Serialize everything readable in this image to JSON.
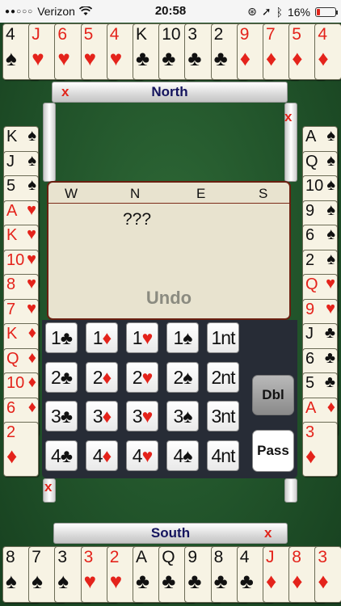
{
  "status_bar": {
    "carrier": "Verizon",
    "time": "20:58",
    "battery": "16%",
    "battery_level": 0.16,
    "icons": [
      "signal-dots",
      "wifi-icon",
      "orientation-lock-icon",
      "location-icon",
      "bluetooth-icon",
      "battery-icon"
    ]
  },
  "colors": {
    "felt": "#21532a",
    "red_suit": "#e4231b",
    "name_text": "#14145e",
    "x_red": "#e0261b"
  },
  "suits": {
    "S": "♠",
    "H": "♥",
    "D": "♦",
    "C": "♣"
  },
  "north": {
    "name": "North",
    "close": "x",
    "cards": [
      {
        "rank": "4",
        "suit": "S"
      },
      {
        "rank": "J",
        "suit": "H"
      },
      {
        "rank": "6",
        "suit": "H"
      },
      {
        "rank": "5",
        "suit": "H"
      },
      {
        "rank": "4",
        "suit": "H"
      },
      {
        "rank": "K",
        "suit": "C"
      },
      {
        "rank": "10",
        "suit": "C"
      },
      {
        "rank": "3",
        "suit": "C"
      },
      {
        "rank": "2",
        "suit": "C"
      },
      {
        "rank": "9",
        "suit": "D"
      },
      {
        "rank": "7",
        "suit": "D"
      },
      {
        "rank": "5",
        "suit": "D"
      },
      {
        "rank": "4",
        "suit": "D"
      }
    ]
  },
  "west": {
    "close": "x",
    "cards": [
      {
        "rank": "K",
        "suit": "S"
      },
      {
        "rank": "J",
        "suit": "S"
      },
      {
        "rank": "5",
        "suit": "S"
      },
      {
        "rank": "A",
        "suit": "H"
      },
      {
        "rank": "K",
        "suit": "H"
      },
      {
        "rank": "10",
        "suit": "H"
      },
      {
        "rank": "8",
        "suit": "H"
      },
      {
        "rank": "7",
        "suit": "H"
      },
      {
        "rank": "K",
        "suit": "D"
      },
      {
        "rank": "Q",
        "suit": "D"
      },
      {
        "rank": "10",
        "suit": "D"
      },
      {
        "rank": "6",
        "suit": "D"
      },
      {
        "rank": "2",
        "suit": "D"
      }
    ]
  },
  "east": {
    "close": "x",
    "cards": [
      {
        "rank": "A",
        "suit": "S"
      },
      {
        "rank": "Q",
        "suit": "S"
      },
      {
        "rank": "10",
        "suit": "S"
      },
      {
        "rank": "9",
        "suit": "S"
      },
      {
        "rank": "6",
        "suit": "S"
      },
      {
        "rank": "2",
        "suit": "S"
      },
      {
        "rank": "Q",
        "suit": "H"
      },
      {
        "rank": "9",
        "suit": "H"
      },
      {
        "rank": "J",
        "suit": "C"
      },
      {
        "rank": "6",
        "suit": "C"
      },
      {
        "rank": "5",
        "suit": "C"
      },
      {
        "rank": "A",
        "suit": "D"
      },
      {
        "rank": "3",
        "suit": "D"
      }
    ]
  },
  "south": {
    "name": "South",
    "close": "x",
    "cards": [
      {
        "rank": "8",
        "suit": "S"
      },
      {
        "rank": "7",
        "suit": "S"
      },
      {
        "rank": "3",
        "suit": "S"
      },
      {
        "rank": "3",
        "suit": "H"
      },
      {
        "rank": "2",
        "suit": "H"
      },
      {
        "rank": "A",
        "suit": "C"
      },
      {
        "rank": "Q",
        "suit": "C"
      },
      {
        "rank": "9",
        "suit": "C"
      },
      {
        "rank": "8",
        "suit": "C"
      },
      {
        "rank": "4",
        "suit": "C"
      },
      {
        "rank": "J",
        "suit": "D"
      },
      {
        "rank": "8",
        "suit": "D"
      },
      {
        "rank": "3",
        "suit": "D"
      }
    ]
  },
  "history": {
    "columns": [
      "W",
      "N",
      "E",
      "S"
    ],
    "entry": "???",
    "undo_label": "Undo"
  },
  "bidbox": {
    "rows": [
      [
        {
          "level": "1",
          "strain": "C"
        },
        {
          "level": "1",
          "strain": "D"
        },
        {
          "level": "1",
          "strain": "H"
        },
        {
          "level": "1",
          "strain": "S"
        },
        {
          "level": "1",
          "strain": "nt"
        }
      ],
      [
        {
          "level": "2",
          "strain": "C"
        },
        {
          "level": "2",
          "strain": "D"
        },
        {
          "level": "2",
          "strain": "H"
        },
        {
          "level": "2",
          "strain": "S"
        },
        {
          "level": "2",
          "strain": "nt"
        }
      ],
      [
        {
          "level": "3",
          "strain": "C"
        },
        {
          "level": "3",
          "strain": "D"
        },
        {
          "level": "3",
          "strain": "H"
        },
        {
          "level": "3",
          "strain": "S"
        },
        {
          "level": "3",
          "strain": "nt"
        }
      ],
      [
        {
          "level": "4",
          "strain": "C"
        },
        {
          "level": "4",
          "strain": "D"
        },
        {
          "level": "4",
          "strain": "H"
        },
        {
          "level": "4",
          "strain": "S"
        },
        {
          "level": "4",
          "strain": "nt"
        }
      ]
    ],
    "dbl_label": "Dbl",
    "pass_label": "Pass"
  }
}
